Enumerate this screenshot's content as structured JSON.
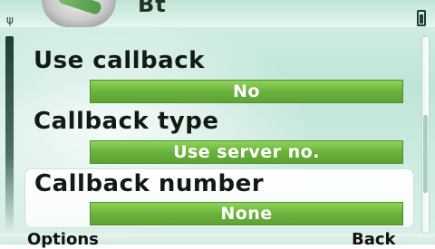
{
  "header": {
    "title": "Bt",
    "icons": {
      "app": "tools-app-icon",
      "signal": "signal-icon",
      "battery": "battery-icon"
    },
    "signal_glyph": "ψ"
  },
  "settings": {
    "items": [
      {
        "label": "Use callback",
        "value": "No"
      },
      {
        "label": "Callback type",
        "value": "Use server no."
      },
      {
        "label": "Callback number",
        "value": "None"
      }
    ]
  },
  "softkeys": {
    "left": "Options",
    "right": "Back"
  },
  "colors": {
    "accent_green": "#6ab23c",
    "background": "#c7e9dc",
    "text": "#121a14"
  }
}
